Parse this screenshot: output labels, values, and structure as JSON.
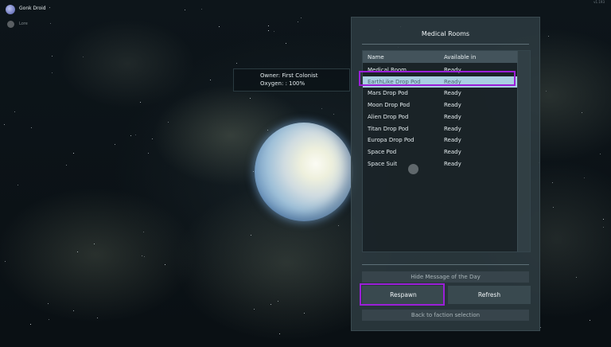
{
  "player": {
    "name": "Gonk Droid",
    "subtitle": "Lore"
  },
  "corner_label": "v1.193",
  "planet_info": {
    "owner": "Owner: First Colonist",
    "oxygen": "Oxygen: : 100%"
  },
  "panel": {
    "title": "Medical Rooms",
    "columns": [
      "Name",
      "Available in"
    ],
    "rows": [
      {
        "name": "Medical Room",
        "status": "Ready",
        "selected": false
      },
      {
        "name": "EarthLike Drop Pod",
        "status": "Ready",
        "selected": true
      },
      {
        "name": "Mars Drop Pod",
        "status": "Ready",
        "selected": false
      },
      {
        "name": "Moon Drop Pod",
        "status": "Ready",
        "selected": false
      },
      {
        "name": "Alien Drop Pod",
        "status": "Ready",
        "selected": false
      },
      {
        "name": "Titan Drop Pod",
        "status": "Ready",
        "selected": false
      },
      {
        "name": "Europa Drop Pod",
        "status": "Ready",
        "selected": false
      },
      {
        "name": "Space Pod",
        "status": "Ready",
        "selected": false
      },
      {
        "name": "Space Suit",
        "status": "Ready",
        "selected": false
      }
    ],
    "hide_motd_label": "Hide Message of the Day",
    "respawn_label": "Respawn",
    "refresh_label": "Refresh",
    "back_label": "Back to faction selection"
  },
  "colors": {
    "highlight": "#9b1fd8",
    "selected_row": "#a9cfe2"
  }
}
